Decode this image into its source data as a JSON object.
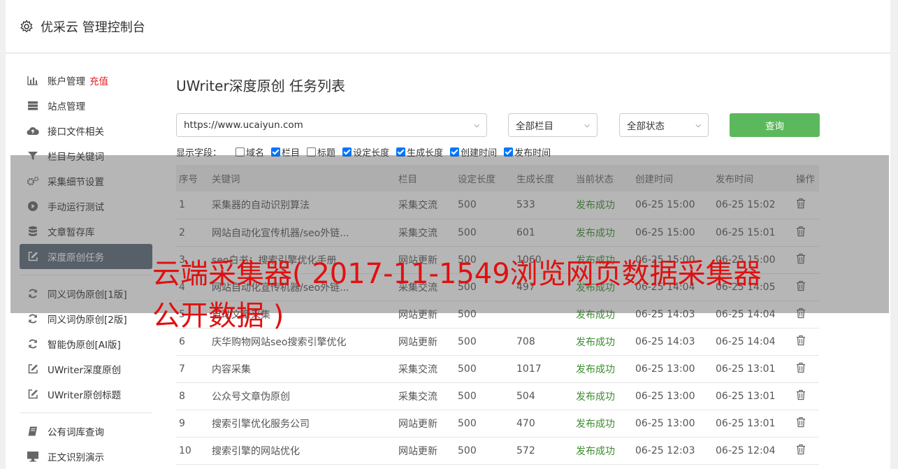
{
  "header": {
    "title": "优采云 管理控制台"
  },
  "sidebar": {
    "items": [
      {
        "label": "账户管理",
        "badge": "充值",
        "icon": "bar-chart-icon"
      },
      {
        "label": "站点管理",
        "icon": "server-icon"
      },
      {
        "label": "接口文件相关",
        "icon": "cloud-upload-icon"
      },
      {
        "label": "栏目与关键词",
        "icon": "filter-icon"
      },
      {
        "label": "采集细节设置",
        "icon": "cogs-icon"
      },
      {
        "label": "手动运行测试",
        "icon": "play-icon"
      },
      {
        "label": "文章暂存库",
        "icon": "database-icon"
      },
      {
        "label": "深度原创任务",
        "icon": "edit-icon"
      },
      {
        "label": "同义词伪原创[1版]",
        "icon": "refresh-icon"
      },
      {
        "label": "同义词伪原创[2版]",
        "icon": "refresh-icon"
      },
      {
        "label": "智能伪原创[AI版]",
        "icon": "refresh-icon"
      },
      {
        "label": "UWriter深度原创",
        "icon": "edit-icon"
      },
      {
        "label": "UWriter原创标题",
        "icon": "edit-icon"
      },
      {
        "label": "公有词库查询",
        "icon": "book-icon"
      },
      {
        "label": "正文识别演示",
        "icon": "monitor-icon"
      }
    ]
  },
  "main": {
    "title": "UWriter深度原创 任务列表",
    "site_select": "https://www.ucaiyun.com",
    "column_select": "全部栏目",
    "status_select": "全部状态",
    "query_button": "查询",
    "fields_label": "显示字段：",
    "fields": [
      {
        "label": "域名",
        "checked": false
      },
      {
        "label": "栏目",
        "checked": true
      },
      {
        "label": "标题",
        "checked": false
      },
      {
        "label": "设定长度",
        "checked": true
      },
      {
        "label": "生成长度",
        "checked": true
      },
      {
        "label": "创建时间",
        "checked": true
      },
      {
        "label": "发布时间",
        "checked": true
      }
    ],
    "columns": [
      "序号",
      "关键词",
      "栏目",
      "设定长度",
      "生成长度",
      "当前状态",
      "创建时间",
      "发布时间",
      "操作"
    ],
    "rows": [
      [
        "1",
        "采集器的自动识别算法",
        "采集交流",
        "500",
        "533",
        "发布成功",
        "06-25 15:00",
        "06-25 15:02"
      ],
      [
        "2",
        "网站自动化宣传机器/seo外链...",
        "采集交流",
        "500",
        "601",
        "发布成功",
        "06-25 15:00",
        "06-25 15:01"
      ],
      [
        "3",
        "seo白书：搜索引擎优化手册",
        "网站更新",
        "500",
        "1060",
        "发布成功",
        "06-25 15:00",
        "06-25 15:00"
      ],
      [
        "4",
        "网站自动化宣传机器/seo外链...",
        "采集交流",
        "500",
        "497",
        "发布成功",
        "06-25 14:04",
        "06-25 14:05"
      ],
      [
        "5",
        "自动文章采集",
        "网站更新",
        "500",
        "",
        "发布成功",
        "06-25 14:03",
        "06-25 14:04"
      ],
      [
        "6",
        "庆华购物网站seo搜索引擎优化",
        "网站更新",
        "500",
        "708",
        "发布成功",
        "06-25 14:03",
        "06-25 14:04"
      ],
      [
        "7",
        "内容采集",
        "采集交流",
        "500",
        "1017",
        "发布成功",
        "06-25 13:00",
        "06-25 13:01"
      ],
      [
        "8",
        "公众号文章伪原创",
        "采集交流",
        "500",
        "504",
        "发布成功",
        "06-25 13:00",
        "06-25 13:01"
      ],
      [
        "9",
        "搜索引擎优化服务公司",
        "网站更新",
        "500",
        "470",
        "发布成功",
        "06-25 13:00",
        "06-25 13:01"
      ],
      [
        "10",
        "搜索引擎的网站优化",
        "网站更新",
        "500",
        "572",
        "发布成功",
        "06-25 12:03",
        "06-25 12:04"
      ]
    ]
  },
  "watermark": {
    "text": "云端采集器( 2017-11-1549浏览网页数据采集器公开数据 )"
  },
  "colors": {
    "accent_green": "#5cb85c",
    "active_nav": "#5c6b7a",
    "status_green": "#3c8d2f",
    "badge_red": "#e02020"
  }
}
